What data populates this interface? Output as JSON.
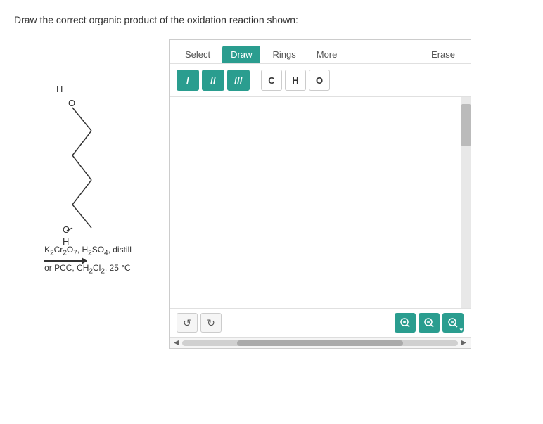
{
  "question": {
    "text": "Draw the correct organic product of the oxidation reaction shown:"
  },
  "reaction": {
    "reagents_line1": "K₂Cr₂O₇, H₂SO₄, distill",
    "reagents_line2": "or PCC, CH₂Cl₂, 25 °C"
  },
  "toolbar": {
    "tabs": [
      {
        "label": "Select",
        "active": false
      },
      {
        "label": "Draw",
        "active": true
      },
      {
        "label": "Rings",
        "active": false
      },
      {
        "label": "More",
        "active": false
      },
      {
        "label": "Erase",
        "active": false
      }
    ],
    "bonds": [
      {
        "symbol": "/",
        "title": "single bond"
      },
      {
        "symbol": "//",
        "title": "double bond"
      },
      {
        "symbol": "///",
        "title": "triple bond"
      }
    ],
    "atoms": [
      {
        "label": "C"
      },
      {
        "label": "H"
      },
      {
        "label": "O"
      }
    ]
  },
  "footer": {
    "undo_label": "↺",
    "redo_label": "↻",
    "zoom_in_label": "🔍+",
    "zoom_reset_label": "🔍",
    "zoom_out_label": "🔍-"
  }
}
